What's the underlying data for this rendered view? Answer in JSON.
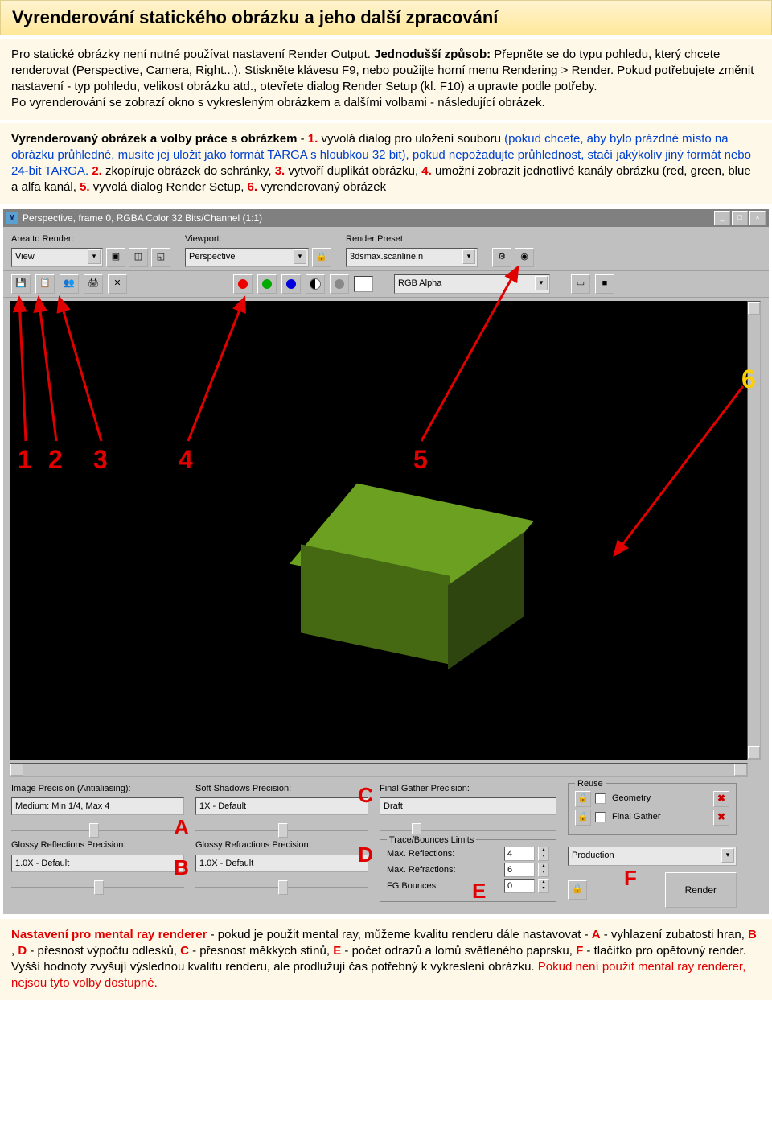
{
  "header": {
    "title": "Vyrenderování statického obrázku a jeho další zpracování"
  },
  "intro": {
    "p1a": "Pro statické obrázky není nutné používat nastavení Render Output. ",
    "p1b_bold": "Jednodušší způsob:",
    "p1c": " Přepněte se do typu pohledu, který chcete renderovat (Perspective, Camera, Right...). Stiskněte klávesu F9, nebo použijte horní menu Rendering > Render. Pokud potřebujete změnit nastavení - typ pohledu, velikost obrázku atd., otevřete dialog Render Setup (kl. F10) a upravte podle potřeby.",
    "p1d": "Po vyrenderování se zobrazí okno s vykresleným obrázkem a dalšími volbami - následující obrázek."
  },
  "legend": {
    "lead": "Vyrenderovaný obrázek a volby práce s obrázkem",
    "dash1": " - ",
    "n1": "1.",
    "t1a": " vyvolá dialog pro uložení souboru ",
    "t1b_blue": "(pokud chcete, aby bylo prázdné místo na obrázku průhledné, musíte jej uložit jako formát TARGA s hloubkou 32 bit), pokud nepožadujte průhlednost, stačí jakýkoliv jiný formát nebo 24-bit TARGA.",
    "n2": " 2.",
    "t2": " zkopíruje obrázek do schránky, ",
    "n3": "3.",
    "t3": " vytvoří duplikát obrázku, ",
    "n4": "4.",
    "t4": " umožní zobrazit jednotlivé kanály obrázku (red, green, blue a alfa kanál, ",
    "n5": "5.",
    "t5": " vyvolá dialog Render Setup, ",
    "n6": "6.",
    "t6": " vyrenderovaný obrázek"
  },
  "win": {
    "title": "Perspective, frame 0, RGBA Color 32 Bits/Channel (1:1)",
    "area_label": "Area to Render:",
    "area_value": "View",
    "viewport_label": "Viewport:",
    "viewport_value": "Perspective",
    "preset_label": "Render Preset:",
    "preset_value": "3dsmax.scanline.n",
    "channel_value": "RGB Alpha"
  },
  "panel": {
    "img_prec_lbl": "Image Precision (Antialiasing):",
    "img_prec_val": "Medium: Min 1/4, Max 4",
    "gloss_refl_lbl": "Glossy Reflections Precision:",
    "gloss_refl_val": "1.0X - Default",
    "soft_sh_lbl": "Soft Shadows Precision:",
    "soft_sh_val": "1X - Default",
    "gloss_refr_lbl": "Glossy Refractions Precision:",
    "gloss_refr_val": "1.0X - Default",
    "fg_lbl": "Final Gather Precision:",
    "fg_val": "Draft",
    "trace_title": "Trace/Bounces Limits",
    "max_refl_lbl": "Max. Reflections:",
    "max_refl_val": "4",
    "max_refr_lbl": "Max. Refractions:",
    "max_refr_val": "6",
    "fg_bounces_lbl": "FG Bounces:",
    "fg_bounces_val": "0",
    "reuse_title": "Reuse",
    "reuse_geom": "Geometry",
    "reuse_fg": "Final Gather",
    "prod_val": "Production",
    "render_btn": "Render"
  },
  "annots": {
    "A": "A",
    "B": "B",
    "C": "C",
    "D": "D",
    "E": "E",
    "F": "F",
    "n1": "1",
    "n2": "2",
    "n3": "3",
    "n4": "4",
    "n5": "5",
    "n6": "6"
  },
  "footer": {
    "lead": "Nastavení pro mental ray renderer",
    "t0": " - pokud je použit mental ray, můžeme kvalitu renderu dále nastavovat - ",
    "A": "A",
    "ta": " - vyhlazení zubatosti hran, ",
    "B": "B",
    "comma": ", ",
    "D": "D",
    "tbd": " - přesnost výpočtu odlesků, ",
    "C": "C",
    "tc": " - přesnost měkkých stínů, ",
    "E": "E",
    "te": " - počet odrazů a lomů světleného paprsku, ",
    "F": "F",
    "tf": " - tlačítko pro opětovný render. Vyšší hodnoty zvyšují výslednou kvalitu renderu, ale prodlužují čas potřebný k vykreslení obrázku. ",
    "warn": "Pokud není použit mental ray renderer, nejsou tyto volby dostupné."
  }
}
